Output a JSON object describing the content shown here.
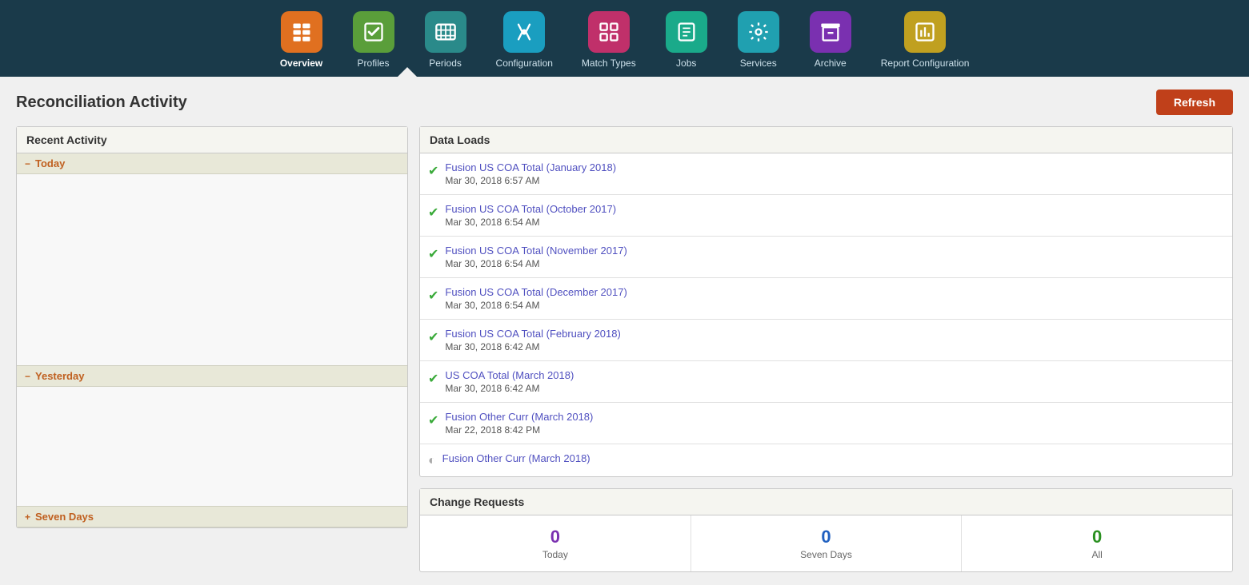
{
  "nav": {
    "items": [
      {
        "id": "overview",
        "label": "Overview",
        "iconColor": "orange",
        "active": true,
        "icon": "📋"
      },
      {
        "id": "profiles",
        "label": "Profiles",
        "iconColor": "green",
        "active": false,
        "icon": "✅"
      },
      {
        "id": "periods",
        "label": "Periods",
        "iconColor": "teal-dark",
        "active": false,
        "icon": "▦"
      },
      {
        "id": "configuration",
        "label": "Configuration",
        "iconColor": "cyan",
        "active": false,
        "icon": "🔧"
      },
      {
        "id": "match-types",
        "label": "Match Types",
        "iconColor": "pink",
        "active": false,
        "icon": "⊞"
      },
      {
        "id": "jobs",
        "label": "Jobs",
        "iconColor": "blue-green",
        "active": false,
        "icon": "📋"
      },
      {
        "id": "services",
        "label": "Services",
        "iconColor": "teal2",
        "active": false,
        "icon": "⚙"
      },
      {
        "id": "archive",
        "label": "Archive",
        "iconColor": "purple",
        "active": false,
        "icon": "▤"
      },
      {
        "id": "report-configuration",
        "label": "Report Configuration",
        "iconColor": "gold",
        "active": false,
        "icon": "📊"
      }
    ]
  },
  "page": {
    "title": "Reconciliation Activity",
    "refresh_label": "Refresh"
  },
  "recent_activity": {
    "header": "Recent Activity",
    "today_label": "Today",
    "yesterday_label": "Yesterday",
    "seven_days_label": "Seven Days"
  },
  "data_loads": {
    "header": "Data Loads",
    "items": [
      {
        "title": "Fusion US COA Total (January 2018)",
        "date": "Mar 30, 2018 6:57 AM",
        "status": "success"
      },
      {
        "title": "Fusion US COA Total (October 2017)",
        "date": "Mar 30, 2018 6:54 AM",
        "status": "success"
      },
      {
        "title": "Fusion US COA Total (November 2017)",
        "date": "Mar 30, 2018 6:54 AM",
        "status": "success"
      },
      {
        "title": "Fusion US COA Total (December 2017)",
        "date": "Mar 30, 2018 6:54 AM",
        "status": "success"
      },
      {
        "title": "Fusion US COA Total (February 2018)",
        "date": "Mar 30, 2018 6:42 AM",
        "status": "success"
      },
      {
        "title": "US COA Total (March 2018)",
        "date": "Mar 30, 2018 6:42 AM",
        "status": "success"
      },
      {
        "title": "Fusion Other Curr (March 2018)",
        "date": "Mar 22, 2018 8:42 PM",
        "status": "success"
      },
      {
        "title": "Fusion Other Curr (March 2018)",
        "date": "",
        "status": "pending"
      }
    ]
  },
  "change_requests": {
    "header": "Change Requests",
    "stats": [
      {
        "label": "Today",
        "value": "0",
        "color": "purple-num"
      },
      {
        "label": "Seven Days",
        "value": "0",
        "color": "blue-num"
      },
      {
        "label": "All",
        "value": "0",
        "color": "green-num"
      }
    ]
  }
}
